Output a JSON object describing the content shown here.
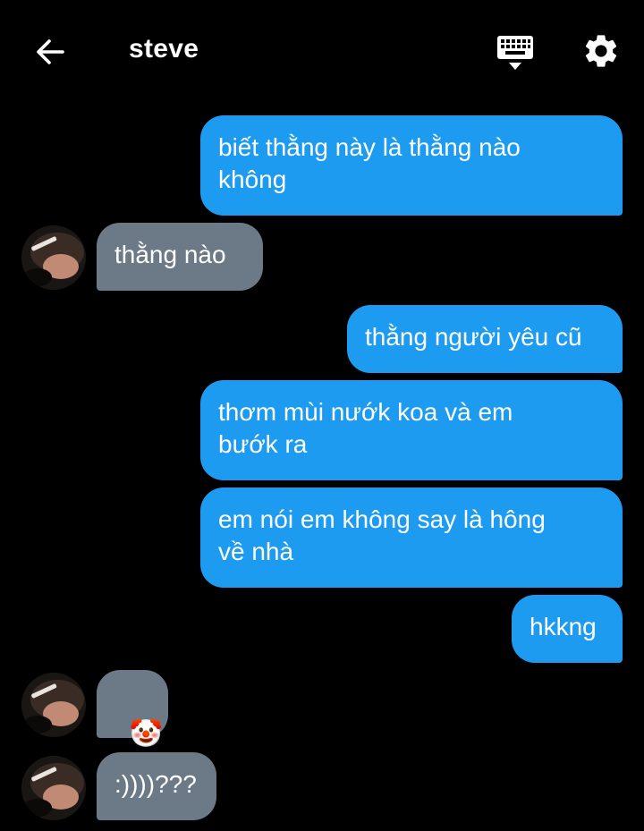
{
  "header": {
    "title": "steve",
    "back_icon": "arrow-left-icon",
    "keyboard_icon": "keyboard-icon",
    "settings_icon": "gear-icon"
  },
  "colors": {
    "background": "#000000",
    "sent_bubble": "#1d9bf0",
    "received_bubble": "#6b7a86",
    "text": "#ffffff"
  },
  "messages": [
    {
      "direction": "sent",
      "text": "biết thằng này là thằng nào\nkhông"
    },
    {
      "direction": "received",
      "text": "thằng nào"
    },
    {
      "direction": "sent",
      "text": "thằng người yêu cũ"
    },
    {
      "direction": "sent",
      "text": "thơm mùi nướk koa và em\nbướk ra"
    },
    {
      "direction": "sent",
      "text": "em nói em không say là hông\nvề nhà"
    },
    {
      "direction": "sent",
      "text": "hkkng"
    },
    {
      "direction": "received",
      "text": "🤡"
    },
    {
      "direction": "received",
      "text": ":))))???"
    }
  ]
}
